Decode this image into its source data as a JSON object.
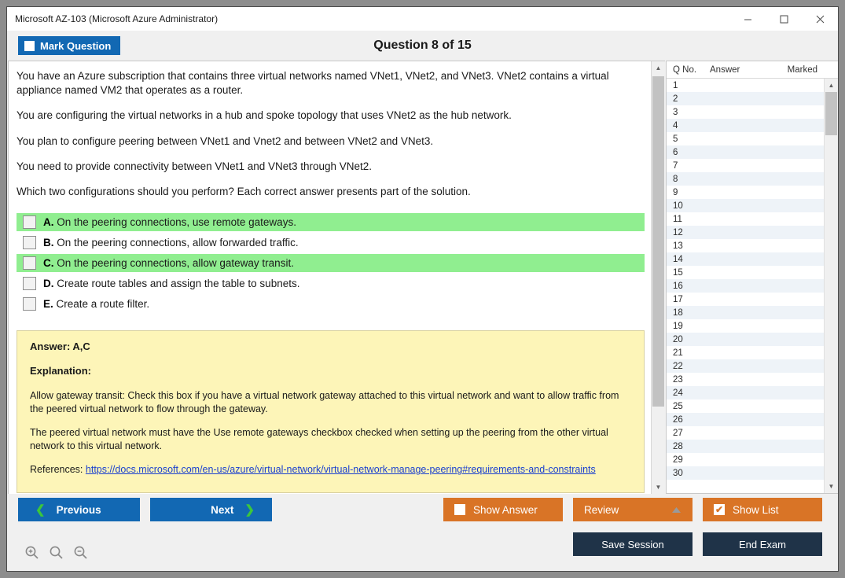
{
  "window": {
    "title": "Microsoft AZ-103 (Microsoft Azure Administrator)",
    "minimize_label": "Minimize",
    "maximize_label": "Maximize",
    "close_label": "Close"
  },
  "header": {
    "mark_question_label": "Mark Question",
    "question_title": "Question 8 of 15"
  },
  "question": {
    "paragraphs": [
      "You have an Azure subscription that contains three virtual networks named VNet1, VNet2, and VNet3. VNet2 contains a virtual appliance named VM2 that operates as a router.",
      "You are configuring the virtual networks in a hub and spoke topology that uses VNet2 as the hub network.",
      "You plan to configure peering between VNet1 and Vnet2 and between VNet2 and VNet3.",
      "You need to provide connectivity between VNet1 and VNet3 through VNet2.",
      "Which two configurations should you perform? Each correct answer presents part of the solution."
    ],
    "options": [
      {
        "letter": "A.",
        "text": "On the peering connections, use remote gateways.",
        "correct": true
      },
      {
        "letter": "B.",
        "text": "On the peering connections, allow forwarded traffic.",
        "correct": false
      },
      {
        "letter": "C.",
        "text": "On the peering connections, allow gateway transit.",
        "correct": true
      },
      {
        "letter": "D.",
        "text": "Create route tables and assign the table to subnets.",
        "correct": false
      },
      {
        "letter": "E.",
        "text": "Create a route filter.",
        "correct": false
      }
    ]
  },
  "explanation": {
    "answer_label": "Answer: A,C",
    "explanation_label": "Explanation:",
    "paragraph1": "Allow gateway transit: Check this box if you have a virtual network gateway attached to this virtual network and want to allow traffic from the peered virtual network to flow through the gateway.",
    "paragraph2": "The peered virtual network must have the Use remote gateways checkbox checked when setting up the peering from the other virtual network to this virtual network.",
    "references_label": "References:",
    "reference_link": "https://docs.microsoft.com/en-us/azure/virtual-network/virtual-network-manage-peering#requirements-and-constraints"
  },
  "list": {
    "columns": [
      "Q No.",
      "Answer",
      "Marked"
    ],
    "rows": [
      {
        "no": "1",
        "answer": "",
        "marked": ""
      },
      {
        "no": "2",
        "answer": "",
        "marked": ""
      },
      {
        "no": "3",
        "answer": "",
        "marked": ""
      },
      {
        "no": "4",
        "answer": "",
        "marked": ""
      },
      {
        "no": "5",
        "answer": "",
        "marked": ""
      },
      {
        "no": "6",
        "answer": "",
        "marked": ""
      },
      {
        "no": "7",
        "answer": "",
        "marked": ""
      },
      {
        "no": "8",
        "answer": "",
        "marked": ""
      },
      {
        "no": "9",
        "answer": "",
        "marked": ""
      },
      {
        "no": "10",
        "answer": "",
        "marked": ""
      },
      {
        "no": "11",
        "answer": "",
        "marked": ""
      },
      {
        "no": "12",
        "answer": "",
        "marked": ""
      },
      {
        "no": "13",
        "answer": "",
        "marked": ""
      },
      {
        "no": "14",
        "answer": "",
        "marked": ""
      },
      {
        "no": "15",
        "answer": "",
        "marked": ""
      },
      {
        "no": "16",
        "answer": "",
        "marked": ""
      },
      {
        "no": "17",
        "answer": "",
        "marked": ""
      },
      {
        "no": "18",
        "answer": "",
        "marked": ""
      },
      {
        "no": "19",
        "answer": "",
        "marked": ""
      },
      {
        "no": "20",
        "answer": "",
        "marked": ""
      },
      {
        "no": "21",
        "answer": "",
        "marked": ""
      },
      {
        "no": "22",
        "answer": "",
        "marked": ""
      },
      {
        "no": "23",
        "answer": "",
        "marked": ""
      },
      {
        "no": "24",
        "answer": "",
        "marked": ""
      },
      {
        "no": "25",
        "answer": "",
        "marked": ""
      },
      {
        "no": "26",
        "answer": "",
        "marked": ""
      },
      {
        "no": "27",
        "answer": "",
        "marked": ""
      },
      {
        "no": "28",
        "answer": "",
        "marked": ""
      },
      {
        "no": "29",
        "answer": "",
        "marked": ""
      },
      {
        "no": "30",
        "answer": "",
        "marked": ""
      }
    ]
  },
  "footer": {
    "previous_label": "Previous",
    "next_label": "Next",
    "show_answer_label": "Show Answer",
    "show_answer_checked": false,
    "review_label": "Review",
    "show_list_label": "Show List",
    "show_list_checked": true,
    "save_session_label": "Save Session",
    "end_exam_label": "End Exam",
    "zoom_in_label": "Zoom In",
    "zoom_reset_label": "Zoom Reset",
    "zoom_out_label": "Zoom Out"
  },
  "colors": {
    "accent_blue": "#1268b3",
    "accent_orange": "#d97426",
    "navy": "#1f3348",
    "correct_green": "#90ee90",
    "explanation_yellow": "#fdf5b8"
  }
}
